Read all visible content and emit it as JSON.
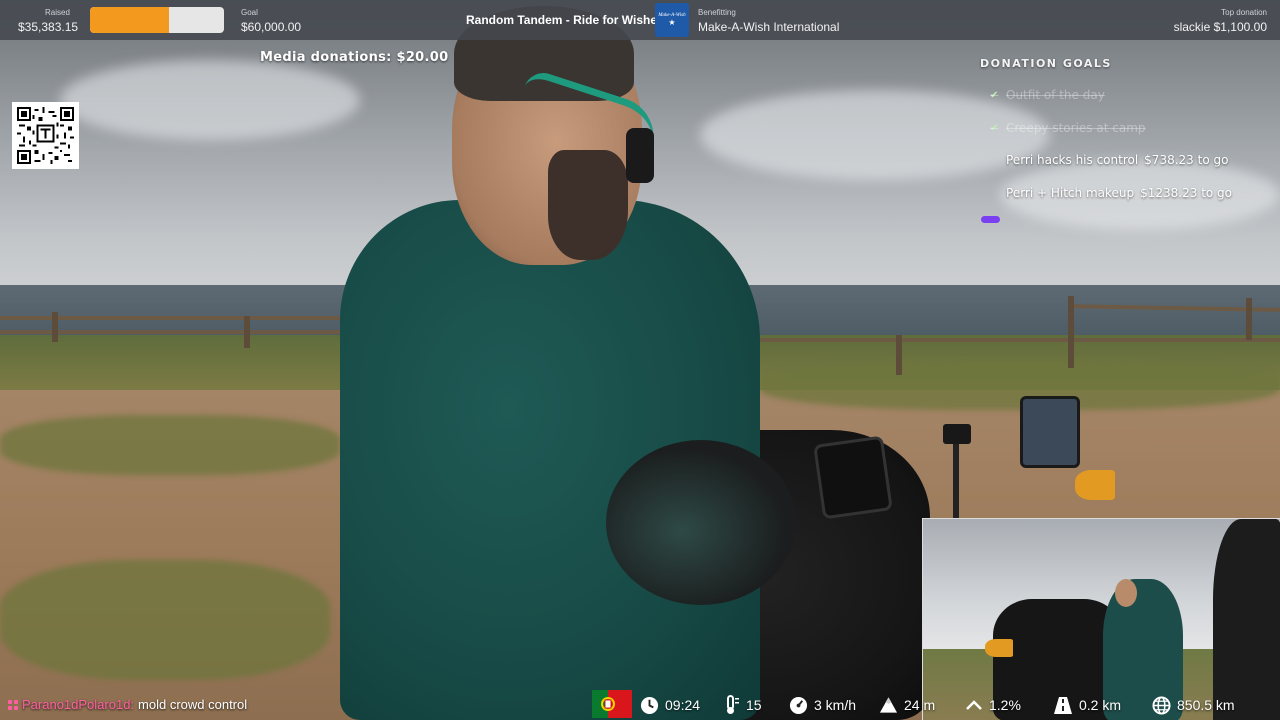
{
  "topbar": {
    "raised_label": "Raised",
    "raised_value": "$35,383.15",
    "progress_fraction": 0.59,
    "goal_label": "Goal",
    "goal_value": "$60,000.00",
    "stream_title": "Random Tandem - Ride for Wishes",
    "charity_logo_text": "Make-A-Wish",
    "benefitting_label": "Benefitting",
    "charity_name": "Make-A-Wish International",
    "top_donation_label": "Top donation",
    "top_donation_value": "slackie $1,100.00"
  },
  "media_donations": "Media donations: $20.00",
  "donation_goals": {
    "title": "DONATION GOALS",
    "items": [
      {
        "label": "Outfit of the day",
        "amount": "",
        "done": true
      },
      {
        "label": "Creepy stories at camp",
        "amount": "",
        "done": true
      },
      {
        "label": "Perri hacks his control",
        "amount": "$738.23 to go",
        "done": false
      },
      {
        "label": "Perri + Hitch makeup",
        "amount": "$1238.23 to go",
        "done": false
      }
    ],
    "accent_color": "#7b3ff2"
  },
  "chat": {
    "username": "Parano1dPolaro1d:",
    "message": "mold crowd control",
    "username_color": "#ff5fa2"
  },
  "stats": {
    "flag": "Portugal",
    "time": "09:24",
    "temperature": "15",
    "speed": "3 km/h",
    "elevation": "24 m",
    "grade": "1.2%",
    "distance_segment": "0.2 km",
    "distance_total": "850.5 km"
  },
  "colors": {
    "progress_fill": "#f39a1e",
    "topbar_bg": "#44484e",
    "charity_blue": "#1e5aa8"
  }
}
